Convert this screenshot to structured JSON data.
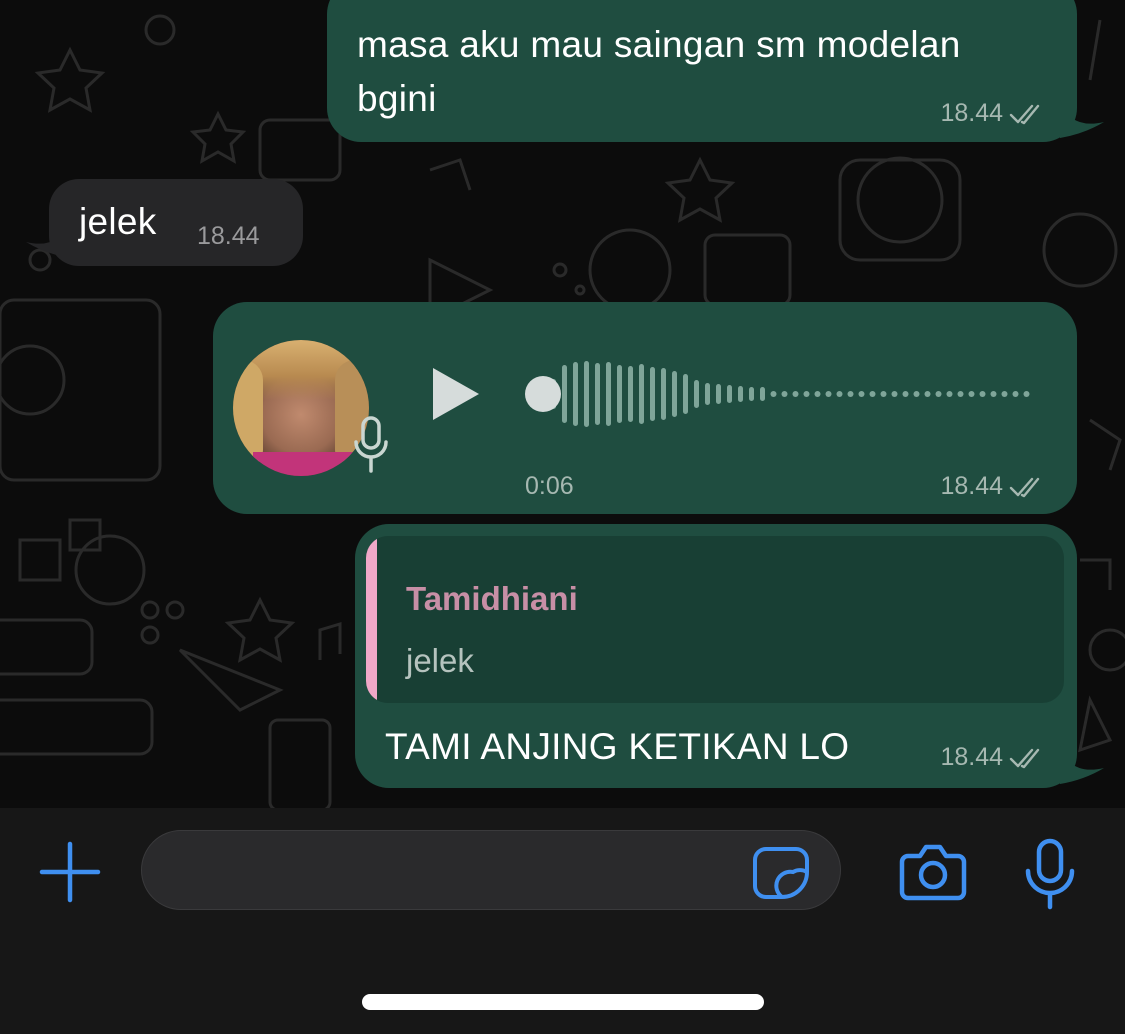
{
  "colors": {
    "outgoing_bubble": "#1f4d40",
    "incoming_bubble": "#262628",
    "accent_blue": "#3f8ff0",
    "reply_name": "#c78fa6",
    "reply_bar": "#f0a8c8"
  },
  "messages": {
    "msg1": {
      "text_line1": "masa aku mau saingan sm modelan",
      "text_line2": "bgini",
      "time": "18.44",
      "status_icon": "double-check-icon"
    },
    "msg2": {
      "text": "jelek",
      "time": "18.44"
    },
    "voice": {
      "duration": "0:06",
      "time": "18.44",
      "status_icon": "double-check-icon",
      "progress": 0
    },
    "reply": {
      "quoted_author": "Tamidhiani",
      "quoted_text": "jelek",
      "text": "TAMI ANJING KETIKAN LO",
      "time": "18.44",
      "status_icon": "double-check-icon"
    }
  },
  "composer": {
    "icons": [
      "plus-icon",
      "sticker-icon",
      "camera-icon",
      "microphone-icon"
    ]
  }
}
